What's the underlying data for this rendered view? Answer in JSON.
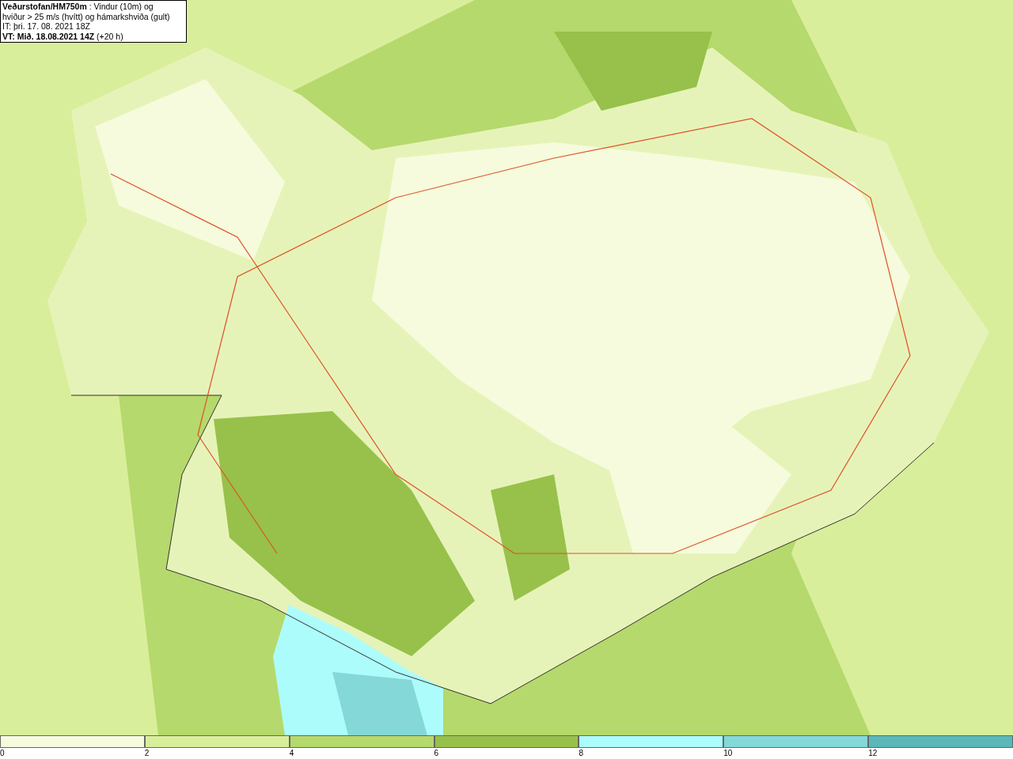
{
  "header": {
    "lines": [
      "**Veðurstofan/HM750m** : Vindur (10m) og",
      "hviður > 25 m/s (hvítt) og hámarkshviða (gult)",
      "IT: þri. 17. 08. 2021 18Z",
      "**VT: Mið. 18.08.2021 14Z** (+20 h)"
    ]
  },
  "legend": {
    "segments": [
      {
        "color": "#f5fbdc",
        "tick": "0"
      },
      {
        "color": "#d9ee9b",
        "tick": "2"
      },
      {
        "color": "#b5d96c",
        "tick": "4"
      },
      {
        "color": "#97c14a",
        "tick": "6"
      },
      {
        "color": "#adfcfc",
        "tick": "8"
      },
      {
        "color": "#85d8d8",
        "tick": "10"
      },
      {
        "color": "#5ab8b8",
        "tick": "12"
      }
    ]
  }
}
